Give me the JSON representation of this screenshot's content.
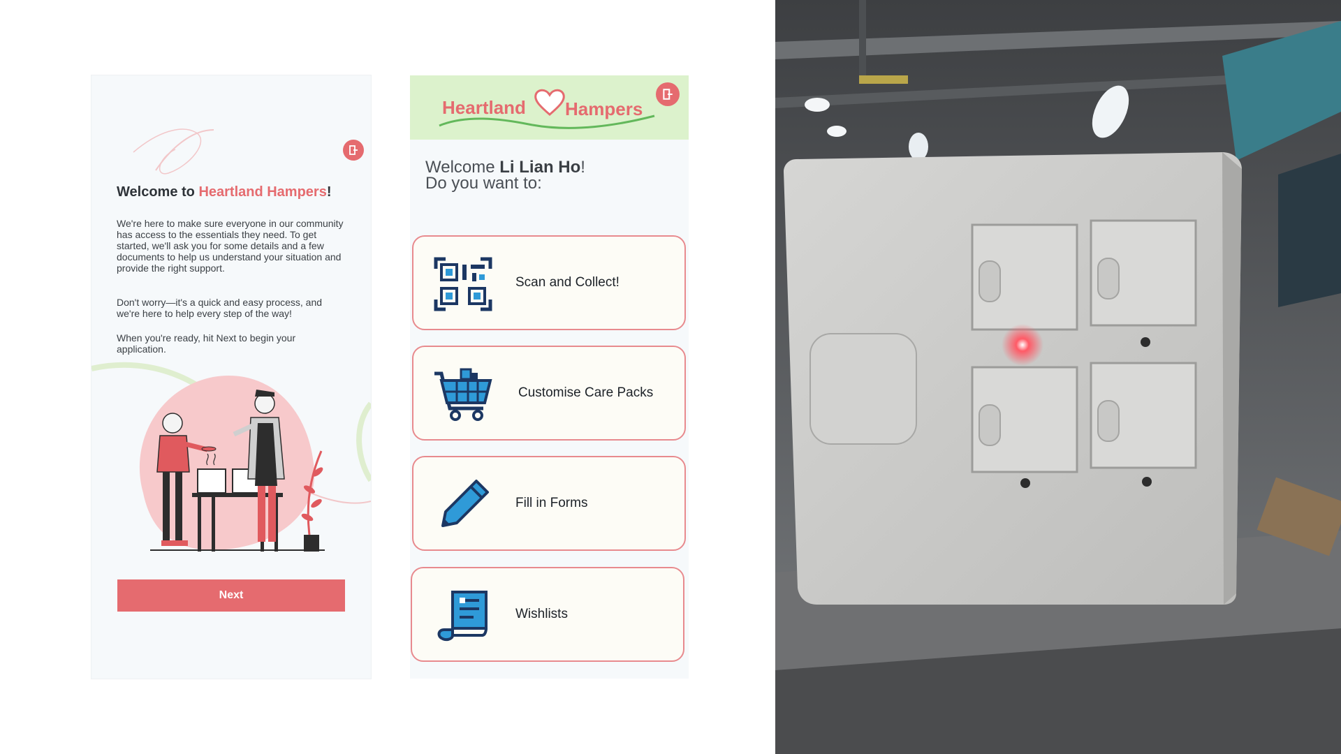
{
  "onboarding": {
    "title_prefix": "Welcome to ",
    "title_brand": "Heartland Hampers",
    "title_suffix": "!",
    "paragraph_1": "We're here to make sure everyone in our community has access to the essentials they need. To get started, we'll ask you for some details and a few documents to help us understand your situation and provide the right support.",
    "paragraph_2": "Don't worry—it's a quick and easy process, and we're here to help every step of the way!",
    "paragraph_3": "When you're ready, hit Next to begin your application.",
    "next_label": "Next"
  },
  "home": {
    "logo_left": "Heartland",
    "logo_right": "Hampers",
    "welcome_prefix": "Welcome ",
    "user_name": "Li Lian Ho",
    "welcome_suffix": "!",
    "prompt": "Do you want to:",
    "actions": [
      {
        "label": "Scan and Collect!",
        "icon": "qr-code-icon"
      },
      {
        "label": "Customise Care Packs",
        "icon": "shopping-cart-icon"
      },
      {
        "label": "Fill in Forms",
        "icon": "pencil-icon"
      },
      {
        "label": "Wishlists",
        "icon": "document-scroll-icon"
      }
    ]
  },
  "colors": {
    "brand_red": "#e56b6f",
    "header_green": "#dcf2cc",
    "icon_blue": "#2f9ad8",
    "icon_navy": "#1c3763",
    "card_border": "#e88a8e"
  }
}
